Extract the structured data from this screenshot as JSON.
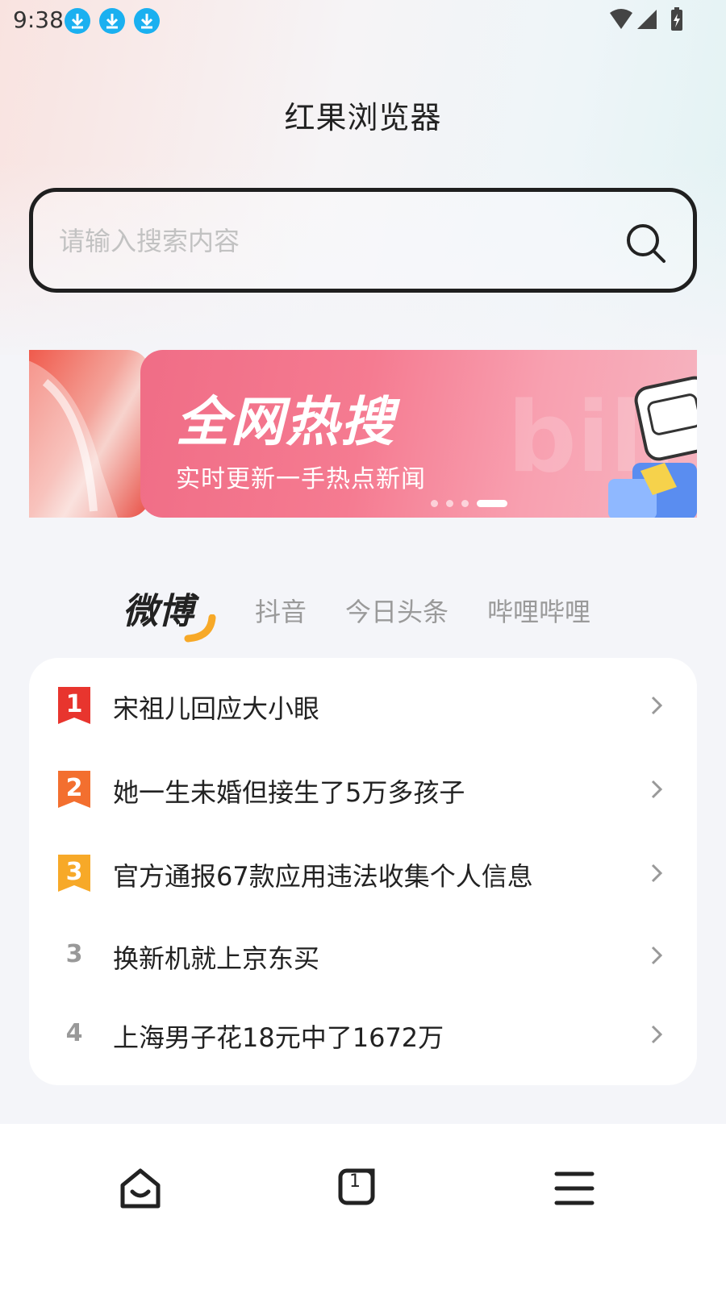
{
  "status_bar": {
    "time": "9:38"
  },
  "app": {
    "title": "红果浏览器"
  },
  "search": {
    "placeholder": "请输入搜索内容"
  },
  "banner": {
    "title": "全网热搜",
    "subtitle": "实时更新一手热点新闻",
    "watermark": "bili",
    "slide_count": 4,
    "active_slide": 4
  },
  "tabs": [
    {
      "label": "微博",
      "active": true
    },
    {
      "label": "抖音",
      "active": false
    },
    {
      "label": "今日头条",
      "active": false
    },
    {
      "label": "哔哩哔哩",
      "active": false
    }
  ],
  "hot_list": [
    {
      "rank": "1",
      "text": "宋祖儿回应大小眼",
      "badge_color": "#e8352e"
    },
    {
      "rank": "2",
      "text": "她一生未婚但接生了5万多孩子",
      "badge_color": "#f36f2f"
    },
    {
      "rank": "3",
      "text": "官方通报67款应用违法收集个人信息",
      "badge_color": "#f7a928"
    },
    {
      "rank": "3",
      "text": "换新机就上京东买",
      "badge_color": ""
    },
    {
      "rank": "4",
      "text": "上海男子花18元中了1672万",
      "badge_color": ""
    }
  ],
  "bottom_nav": {
    "tab_count": "1"
  },
  "colors": {
    "accent": "#1ab0f0",
    "banner_pink": "#f06d86",
    "weibo_orange": "#f7a928"
  }
}
